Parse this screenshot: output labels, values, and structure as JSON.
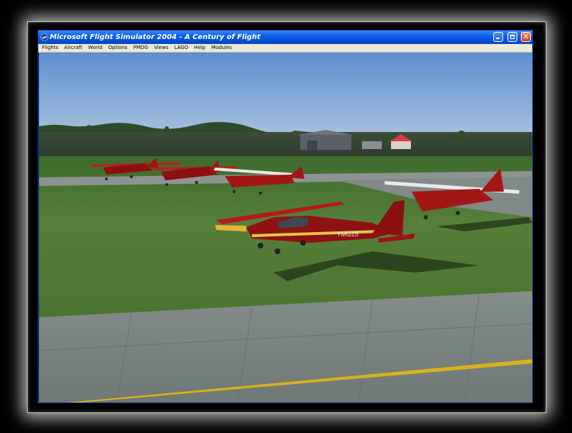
{
  "window": {
    "title": "Microsoft Flight Simulator 2004 - A Century of Flight",
    "controls": {
      "minimize": "minimize-icon",
      "maximize": "maximize-icon",
      "close": "close-icon",
      "close_glyph": "✕"
    }
  },
  "menu": {
    "items": [
      "Flights",
      "Aircraft",
      "World",
      "Options",
      "PMDG",
      "Views",
      "LAGO",
      "Help",
      "Modules"
    ]
  },
  "scene": {
    "aircraft_registration": "TMG15",
    "colors": {
      "sky_top": "#5c8fd0",
      "sky_bottom": "#b9cde0",
      "grass": "#4e7a33",
      "tarmac": "#7e8784",
      "taxi_line": "#d8b21c",
      "plane_red": "#9c1414"
    }
  }
}
